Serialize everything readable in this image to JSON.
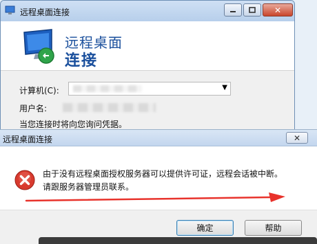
{
  "rdc_window": {
    "title": "远程桌面连接",
    "heading_line1": "远程桌面",
    "heading_line2": "连接",
    "computer_label": "计算机(C):",
    "username_label": "用户名:",
    "credentials_note": "当您连接时将向您询问凭据。",
    "close_glyph": "✕",
    "combo_arrow": "▼",
    "icons": [
      "remote-desktop-icon",
      "minimize-icon",
      "maximize-icon",
      "close-icon",
      "monitor-connection-icon"
    ]
  },
  "error_dialog": {
    "title": "远程桌面连接",
    "close_glyph": "✕",
    "message_line1": "由于没有远程桌面授权服务器可以提供许可证，远程会话被中断。",
    "message_line2": "请跟服务器管理员联系。",
    "ok_label": "确定",
    "help_label": "帮助",
    "icons": [
      "error-icon",
      "red-arrow-annotation"
    ],
    "colors": {
      "error_red": "#d83a2e",
      "arrow_red": "#e8322b",
      "heading_blue": "#1a4f9c"
    }
  }
}
